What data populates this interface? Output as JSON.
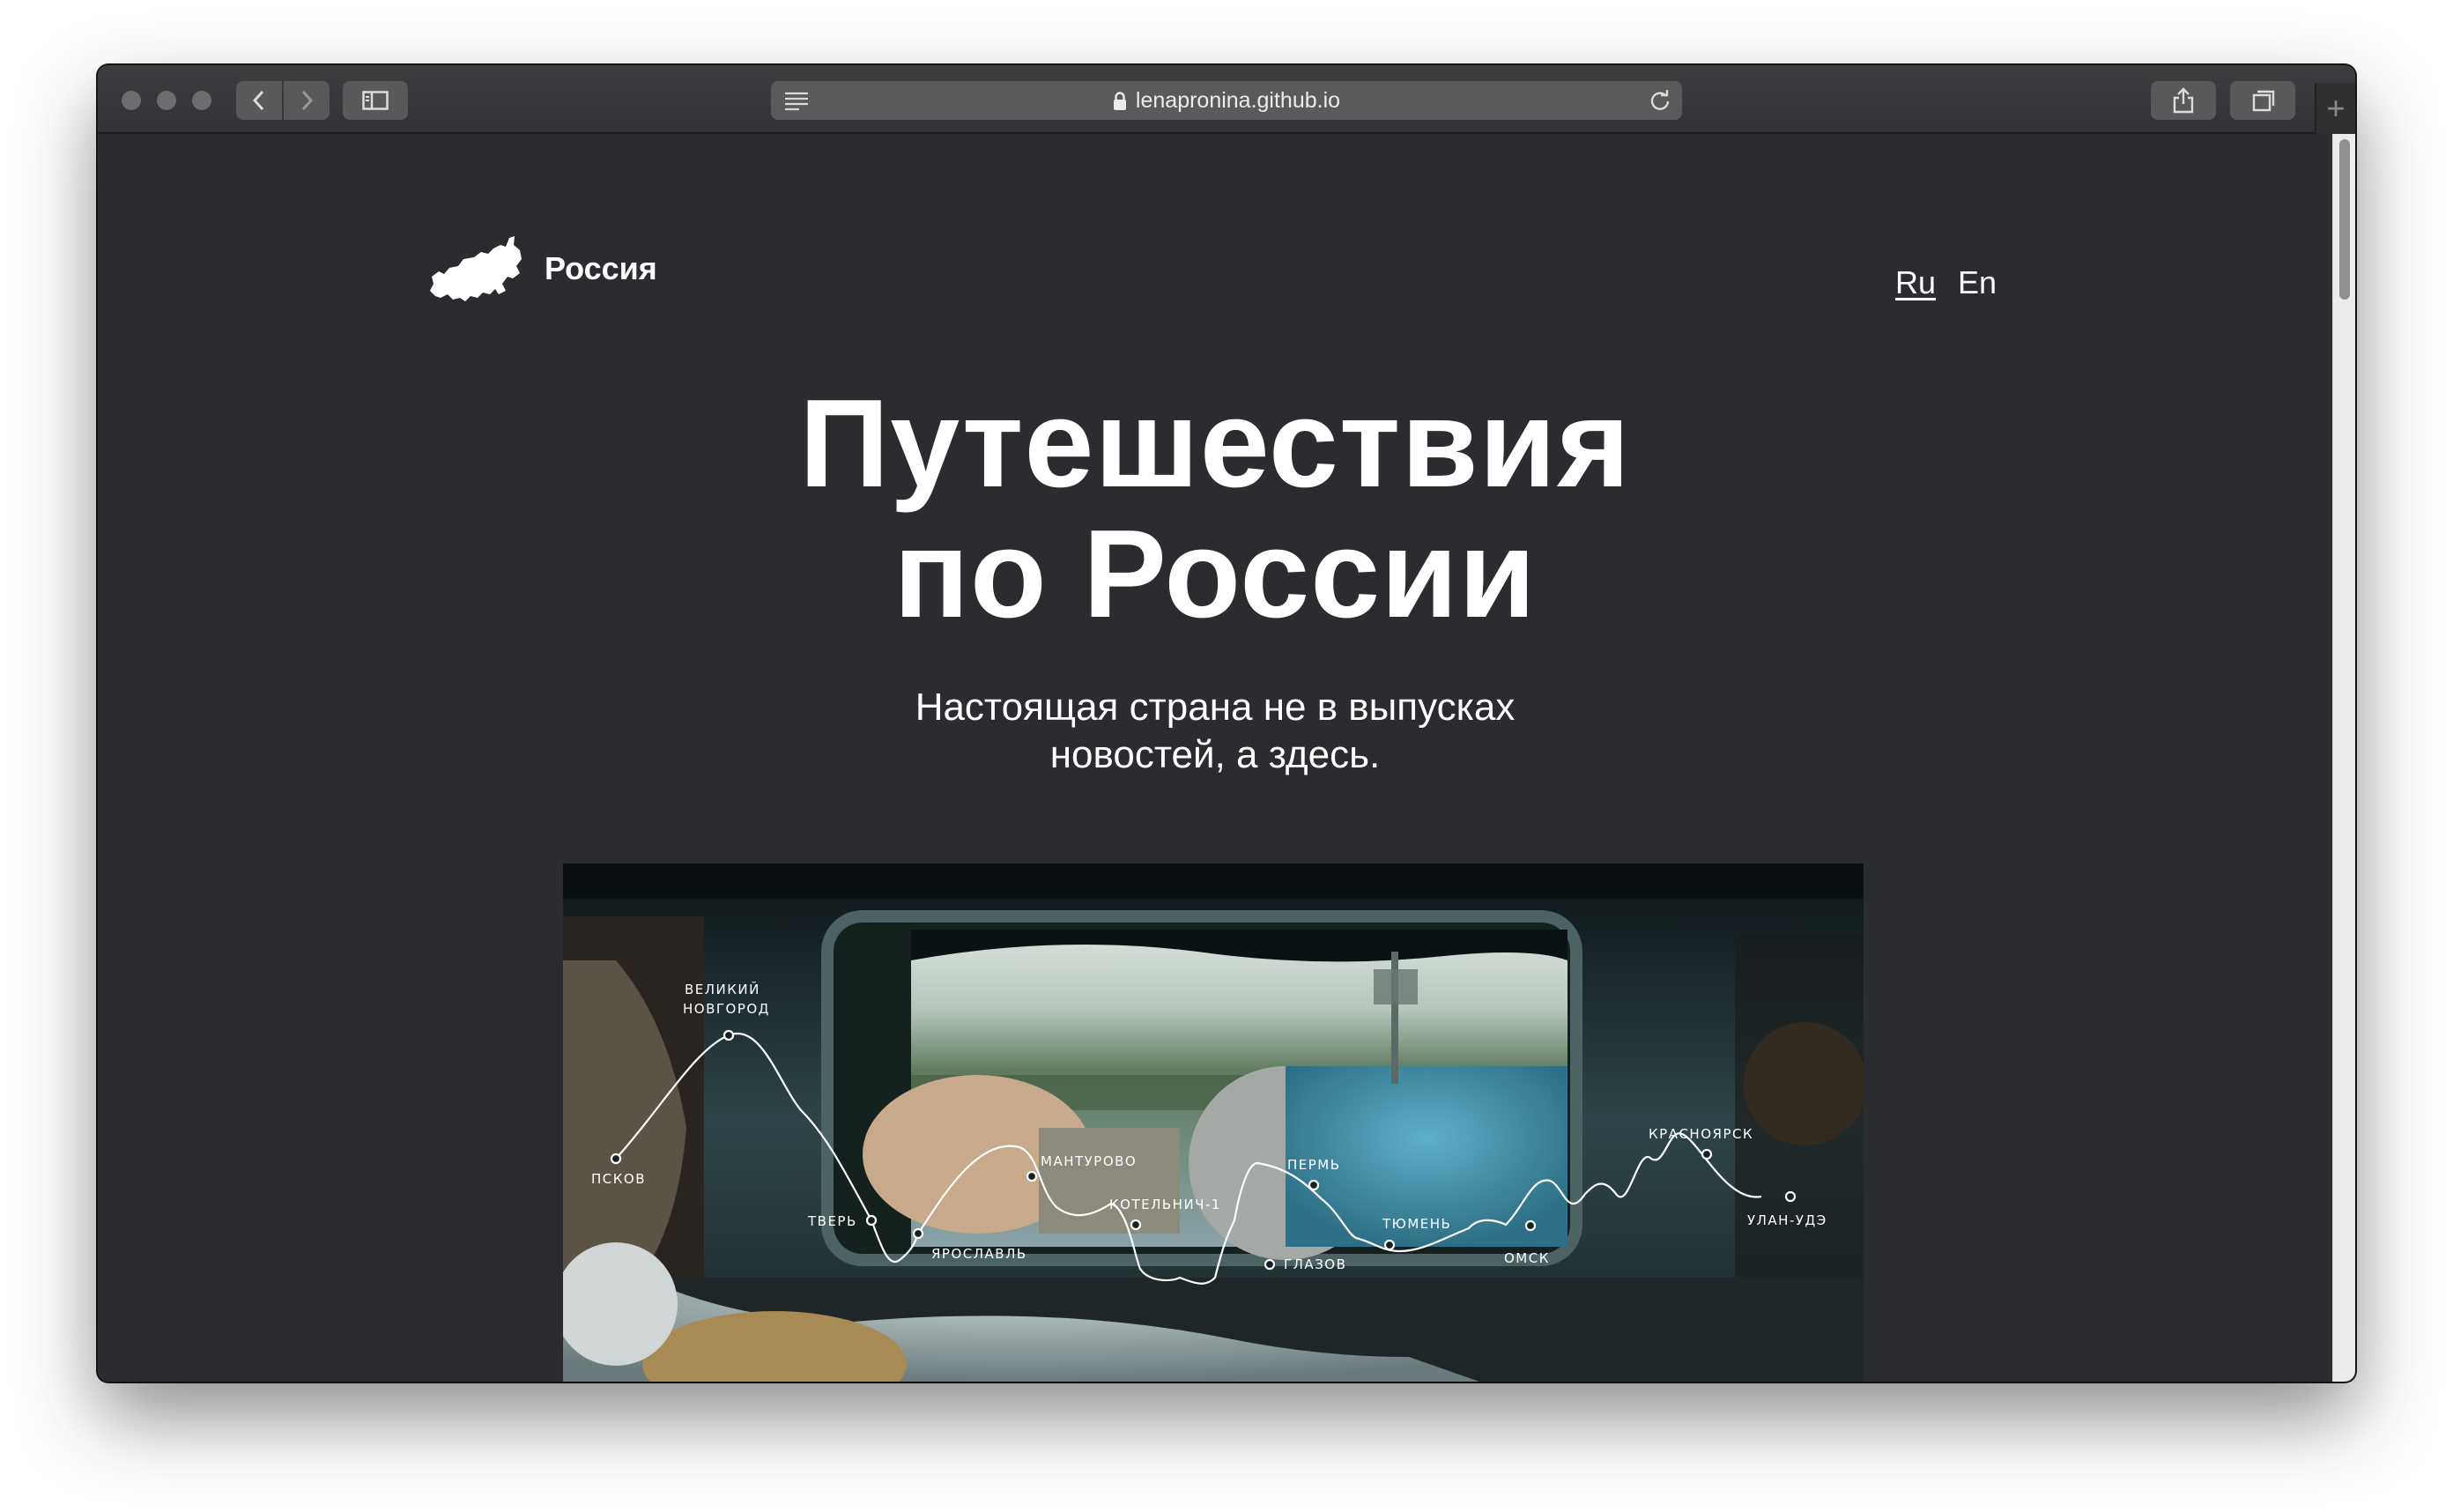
{
  "browser": {
    "url": "lenapronina.github.io",
    "icons": {
      "back": "chevron-left-icon",
      "forward": "chevron-right-icon",
      "sidebar": "sidebar-icon",
      "reader": "reader-icon",
      "lock": "lock-icon",
      "reload": "reload-icon",
      "share": "share-icon",
      "tabs": "tabs-icon",
      "new_tab": "plus-icon"
    }
  },
  "site": {
    "logo_text": "Россия",
    "languages": [
      {
        "label": "Ru",
        "active": true
      },
      {
        "label": "En",
        "active": false
      }
    ]
  },
  "hero": {
    "title_line1": "Путешествия",
    "title_line2": "по России",
    "subtitle_line1": "Настоящая страна не в выпусках",
    "subtitle_line2": "новостей, а здесь."
  },
  "route": {
    "stops": [
      {
        "label": "ПСКОВ"
      },
      {
        "label": "ВЕЛИКИЙ",
        "label2": "НОВГОРОД"
      },
      {
        "label": "ТВЕРЬ"
      },
      {
        "label": "ЯРОСЛАВЛЬ"
      },
      {
        "label": "МАНТУРОВО"
      },
      {
        "label": "КОТЕЛЬНИЧ-1"
      },
      {
        "label": "ГЛАЗОВ"
      },
      {
        "label": "ПЕРМЬ"
      },
      {
        "label": "ТЮМЕНЬ"
      },
      {
        "label": "ОМСК"
      },
      {
        "label": "КРАСНОЯРСК"
      },
      {
        "label": "УЛАН-УДЭ"
      }
    ]
  },
  "colors": {
    "page_bg": "#2b2c30",
    "text": "#ffffff",
    "chrome": "#3a3a3d"
  }
}
